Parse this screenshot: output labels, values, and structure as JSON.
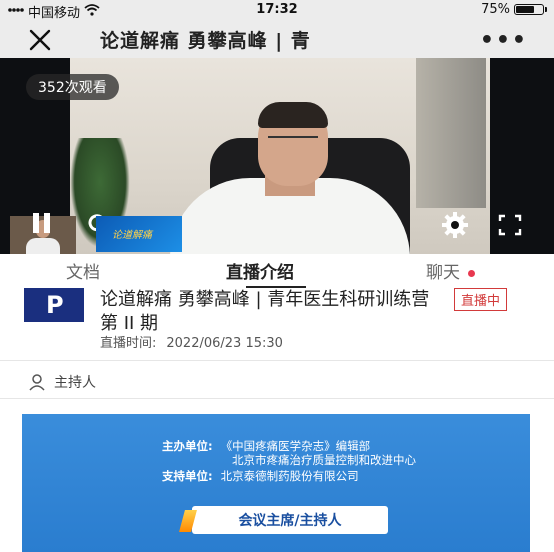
{
  "status_bar": {
    "carrier": "中国移动",
    "time": "17:32",
    "battery_percent": "75%",
    "battery_level": 0.75
  },
  "nav": {
    "title": "论道解痛 勇攀高峰 | 青",
    "more": "•••"
  },
  "video": {
    "viewer_count": "352次观看",
    "banner_text": "论道解痛"
  },
  "tabs": [
    {
      "label": "文档"
    },
    {
      "label": "直播介绍"
    },
    {
      "label": "聊天"
    }
  ],
  "live": {
    "title": "论道解痛 勇攀高峰 | 青年医生科研训练营第 II 期",
    "badge": "直播中",
    "time_label": "直播时间:",
    "time_value": "2022/06/23 15:30",
    "logo_letter": "P"
  },
  "host": {
    "label": "主持人"
  },
  "poster": {
    "host_org_label": "主办单位:",
    "host_org_1": "《中国疼痛医学杂志》编辑部",
    "host_org_2": "北京市疼痛治疗质量控制和改进中心",
    "support_label": "支持单位:",
    "support_org": "北京泰德制药股份有限公司",
    "section_label": "会议主席/主持人"
  }
}
